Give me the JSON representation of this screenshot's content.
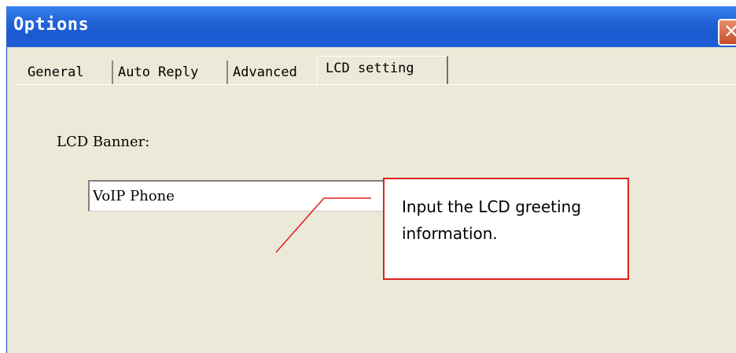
{
  "window": {
    "title": "Options",
    "close_icon": "close-icon",
    "close_glyph": "✕"
  },
  "tabs": [
    {
      "label": "General",
      "active": false
    },
    {
      "label": "Auto Reply",
      "active": false
    },
    {
      "label": "Advanced",
      "active": false
    },
    {
      "label": "LCD setting",
      "active": true
    }
  ],
  "lcd": {
    "label": "LCD Banner:",
    "value": "VoIP Phone"
  },
  "callout": {
    "text": "Input the LCD greeting information.",
    "color": "#e02020"
  },
  "colors": {
    "titlebar": "#2366d9",
    "dialog_bg": "#ece9d8",
    "close_button": "#c74b2a"
  }
}
